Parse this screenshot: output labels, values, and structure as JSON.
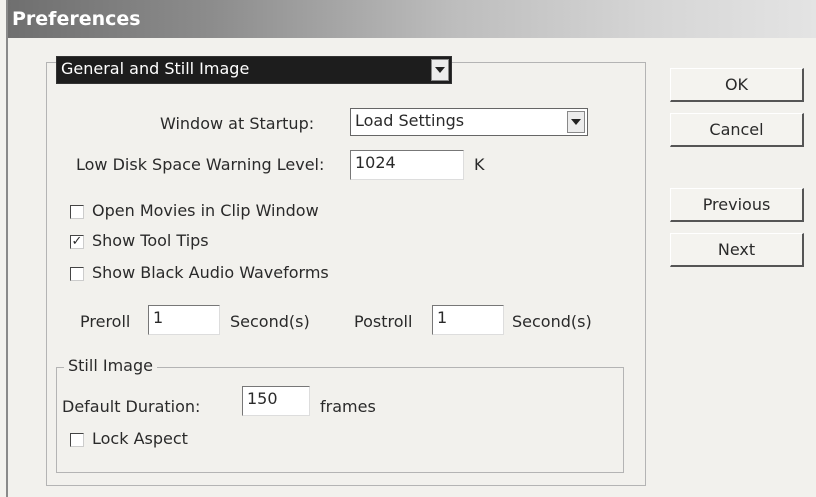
{
  "window": {
    "title": "Preferences"
  },
  "category": {
    "selected": "General and Still Image"
  },
  "general": {
    "startup_label": "Window at Startup:",
    "startup_value": "Load Settings",
    "disk_label": "Low Disk Space Warning Level:",
    "disk_value": "1024",
    "disk_unit": "K",
    "checkboxes": [
      {
        "label": "Open Movies in Clip Window",
        "checked": false
      },
      {
        "label": "Show Tool Tips",
        "checked": true
      },
      {
        "label": "Show Black Audio Waveforms",
        "checked": false
      }
    ],
    "preroll_label": "Preroll",
    "preroll_value": "1",
    "preroll_unit": "Second(s)",
    "postroll_label": "Postroll",
    "postroll_value": "1",
    "postroll_unit": "Second(s)"
  },
  "still_image": {
    "legend": "Still Image",
    "duration_label": "Default Duration:",
    "duration_value": "150",
    "duration_unit": "frames",
    "lock_label": "Lock Aspect",
    "lock_checked": false
  },
  "buttons": {
    "ok": "OK",
    "cancel": "Cancel",
    "previous": "Previous",
    "next": "Next"
  },
  "check_mark": "✓"
}
